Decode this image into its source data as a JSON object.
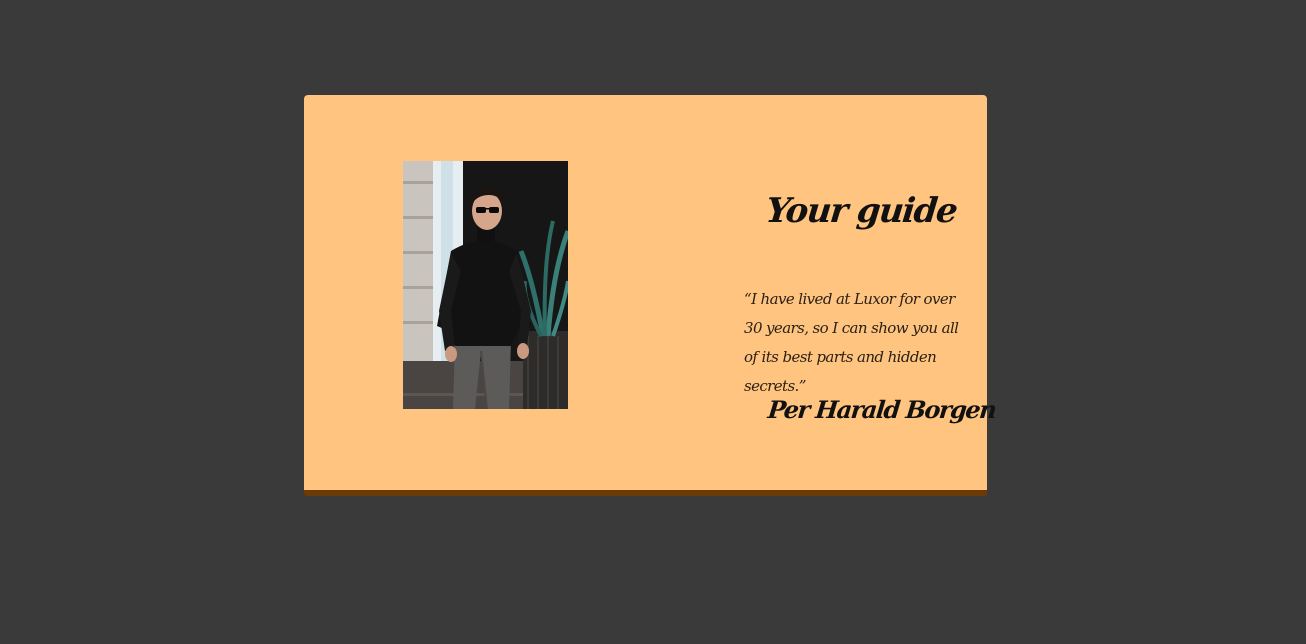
{
  "guide_card": {
    "title": "Your guide",
    "quote": "“I have lived at Luxor for over 30 years, so I can show you all of its best parts and hidden secrets.”",
    "name": "Per Harald Borgen"
  },
  "photo": {
    "icon": "guide-portrait-photo"
  },
  "colors": {
    "page_background": "#3a3a3a",
    "card_background": "#ffc47f",
    "card_border_bottom": "#6b3a06",
    "text": "#111111"
  }
}
